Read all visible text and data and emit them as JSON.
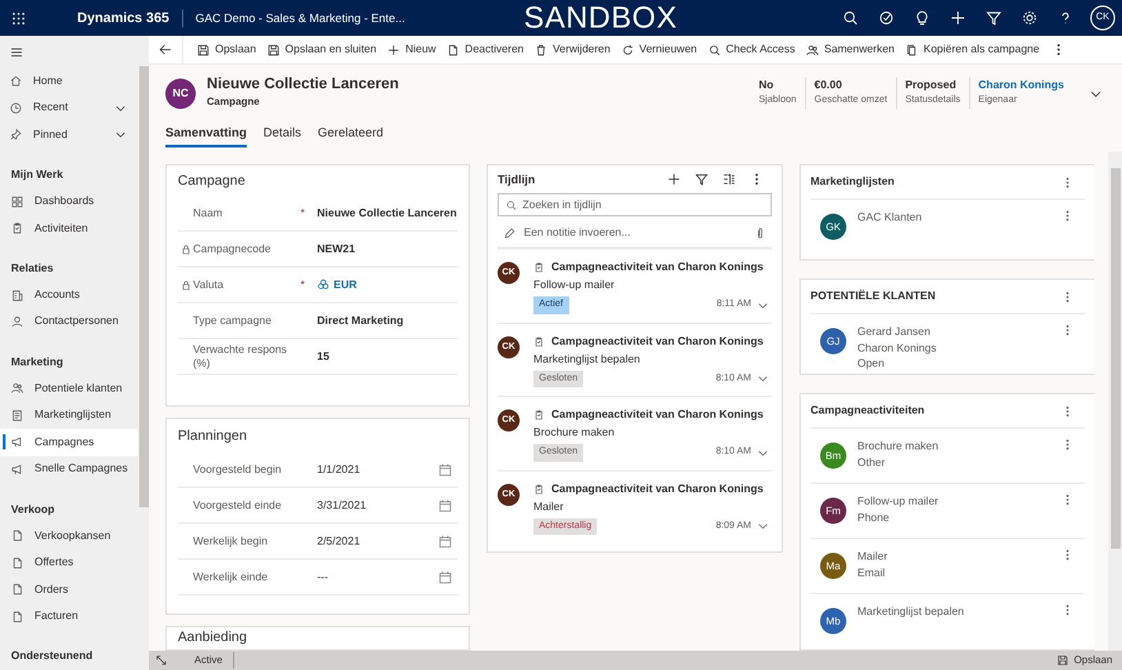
{
  "top_bar": {
    "app_name": "Dynamics 365",
    "environment_title": "GAC Demo - Sales & Marketing - Ente...",
    "banner": "SANDBOX",
    "user_initials": "CK"
  },
  "command_bar": [
    {
      "label": "Opslaan"
    },
    {
      "label": "Opslaan en sluiten"
    },
    {
      "label": "Nieuw"
    },
    {
      "label": "Deactiveren"
    },
    {
      "label": "Verwijderen"
    },
    {
      "label": "Vernieuwen"
    },
    {
      "label": "Check Access"
    },
    {
      "label": "Samenwerken"
    },
    {
      "label": "Kopiëren als campagne"
    }
  ],
  "sidebar": {
    "items": [
      {
        "label": "Home",
        "expandable": false
      },
      {
        "label": "Recent",
        "expandable": true
      },
      {
        "label": "Pinned",
        "expandable": true
      }
    ],
    "groups": [
      {
        "title": "Mijn Werk",
        "items": [
          {
            "label": "Dashboards",
            "selected": false
          },
          {
            "label": "Activiteiten",
            "selected": false
          }
        ]
      },
      {
        "title": "Relaties",
        "items": [
          {
            "label": "Accounts",
            "selected": false
          },
          {
            "label": "Contactpersonen",
            "selected": false
          }
        ]
      },
      {
        "title": "Marketing",
        "items": [
          {
            "label": "Potentiele klanten",
            "selected": false
          },
          {
            "label": "Marketinglijsten",
            "selected": false
          },
          {
            "label": "Campagnes",
            "selected": true
          },
          {
            "label": "Snelle Campagnes",
            "selected": false
          }
        ]
      },
      {
        "title": "Verkoop",
        "items": [
          {
            "label": "Verkoopkansen",
            "selected": false
          },
          {
            "label": "Offertes",
            "selected": false
          },
          {
            "label": "Orders",
            "selected": false
          },
          {
            "label": "Facturen",
            "selected": false
          }
        ]
      },
      {
        "title": "Ondersteunend"
      }
    ]
  },
  "record_header": {
    "initials": "NC",
    "title": "Nieuwe Collectie Lanceren",
    "entity": "Campagne",
    "fields": [
      {
        "value": "No",
        "label": "Sjabloon",
        "kind": "text"
      },
      {
        "value": "€0.00",
        "label": "Geschatte omzet",
        "kind": "text"
      },
      {
        "value": "Proposed",
        "label": "Statusdetails",
        "kind": "text"
      },
      {
        "value": "Charon Konings",
        "label": "Eigenaar",
        "kind": "link"
      }
    ]
  },
  "tabs": [
    {
      "label": "Samenvatting",
      "selected": true
    },
    {
      "label": "Details",
      "selected": false
    },
    {
      "label": "Gerelateerd",
      "selected": false
    }
  ],
  "campagne_section": {
    "title": "Campagne",
    "fields": [
      {
        "label": "Naam",
        "value": "Nieuwe Collectie Lanceren",
        "required_mark": "*",
        "locked": false,
        "kind": "text"
      },
      {
        "label": "Campagnecode",
        "value": "NEW21",
        "locked": true,
        "kind": "text"
      },
      {
        "label": "Valuta",
        "value": "EUR",
        "required_mark": "*",
        "locked": true,
        "kind": "lookup"
      },
      {
        "label": "Type campagne",
        "value": "Direct Marketing",
        "locked": false,
        "kind": "text"
      },
      {
        "label": "Verwachte respons (%)",
        "value": "15",
        "locked": false,
        "kind": "text"
      }
    ]
  },
  "planningen_section": {
    "title": "Planningen",
    "fields": [
      {
        "label": "Voorgesteld begin",
        "value": "1/1/2021"
      },
      {
        "label": "Voorgesteld einde",
        "value": "3/31/2021"
      },
      {
        "label": "Werkelijk begin",
        "value": "2/5/2021"
      },
      {
        "label": "Werkelijk einde",
        "value": "---"
      }
    ]
  },
  "aanbieding_section": {
    "title": "Aanbieding"
  },
  "timeline": {
    "title": "Tijdlijn",
    "search_placeholder": "Zoeken in tijdlijn",
    "note_placeholder": "Een notitie invoeren...",
    "entries": [
      {
        "initials": "CK",
        "title": "Campagneactiviteit van Charon Konings",
        "subject": "Follow-up mailer",
        "status": "Actief",
        "active": true,
        "overdue": false,
        "time": "8:11 AM"
      },
      {
        "initials": "CK",
        "title": "Campagneactiviteit van Charon Konings",
        "subject": "Marketinglijst bepalen",
        "status": "Gesloten",
        "active": false,
        "overdue": false,
        "time": "8:10 AM"
      },
      {
        "initials": "CK",
        "title": "Campagneactiviteit van Charon Konings",
        "subject": "Brochure maken",
        "status": "Gesloten",
        "active": false,
        "overdue": false,
        "time": "8:10 AM"
      },
      {
        "initials": "CK",
        "title": "Campagneactiviteit van Charon Konings",
        "subject": "Mailer",
        "status": "Achterstallig",
        "active": false,
        "overdue": true,
        "time": "8:09 AM"
      }
    ]
  },
  "related_panels": [
    {
      "title": "Marketinglijsten",
      "items": [
        {
          "initials": "GK",
          "color": "#0e5d63",
          "lines": [
            "GAC Klanten"
          ]
        }
      ]
    },
    {
      "title": "POTENTIËLE KLANTEN",
      "items": [
        {
          "initials": "GJ",
          "color": "#2e61ac",
          "lines": [
            "Gerard Jansen",
            "Charon Konings",
            "Open"
          ]
        }
      ]
    },
    {
      "title": "Campagneactiviteiten",
      "items": [
        {
          "initials": "Bm",
          "color": "#3a8b1f",
          "lines": [
            "Brochure maken",
            "Other"
          ]
        },
        {
          "initials": "Fm",
          "color": "#6b2848",
          "lines": [
            "Follow-up mailer",
            "Phone"
          ]
        },
        {
          "initials": "Ma",
          "color": "#7a5b12",
          "lines": [
            "Mailer",
            "Email"
          ]
        },
        {
          "initials": "Mb",
          "color": "#2d64b2",
          "lines": [
            "Marketinglijst bepalen"
          ]
        }
      ]
    }
  ],
  "status_bar": {
    "status": "Active",
    "save_label": "Opslaan"
  }
}
